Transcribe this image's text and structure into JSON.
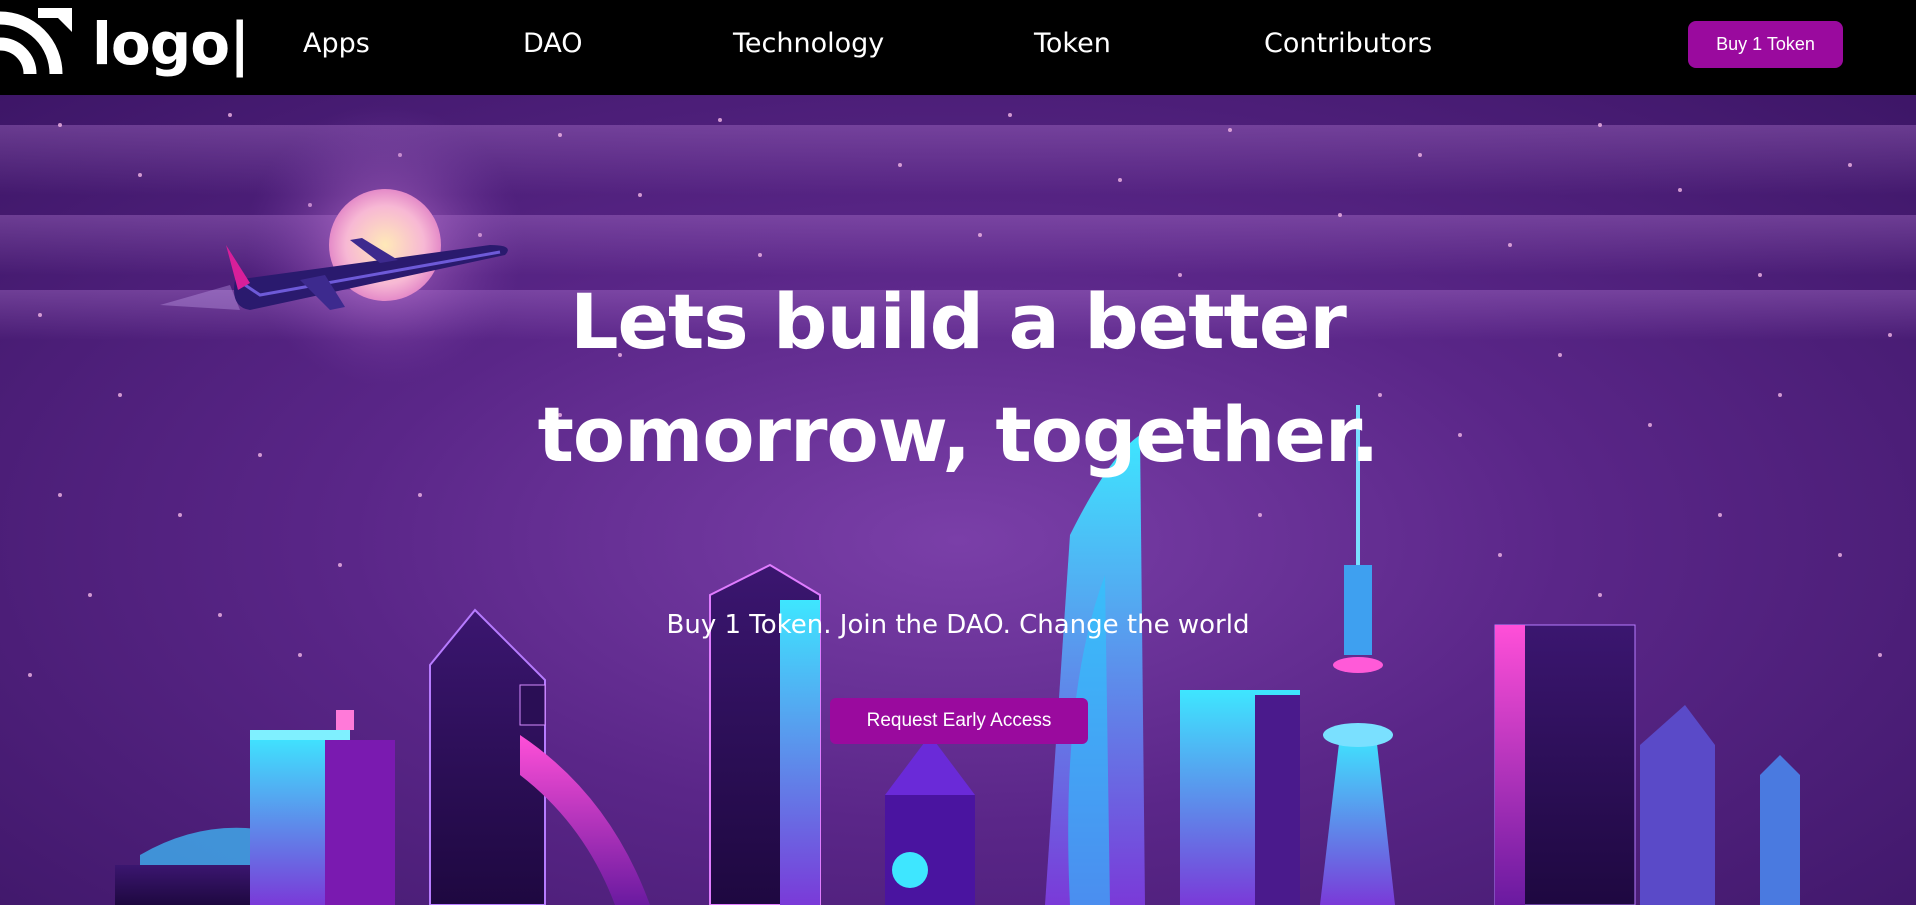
{
  "brand": {
    "logo_text": "logo|"
  },
  "nav": {
    "links": [
      {
        "label": "Apps"
      },
      {
        "label": "DAO"
      },
      {
        "label": "Technology"
      },
      {
        "label": "Token"
      },
      {
        "label": "Contributors"
      }
    ],
    "buy_label": "Buy 1 Token"
  },
  "hero": {
    "headline": "Lets build a better tomorrow, together.",
    "tagline": "Buy 1 Token. Join the DAO. Change the world",
    "cta_label": "Request Early Access"
  },
  "colors": {
    "accent": "#9a0a9e",
    "nav_bg": "#000000",
    "hero_bg": "#5a2688"
  }
}
